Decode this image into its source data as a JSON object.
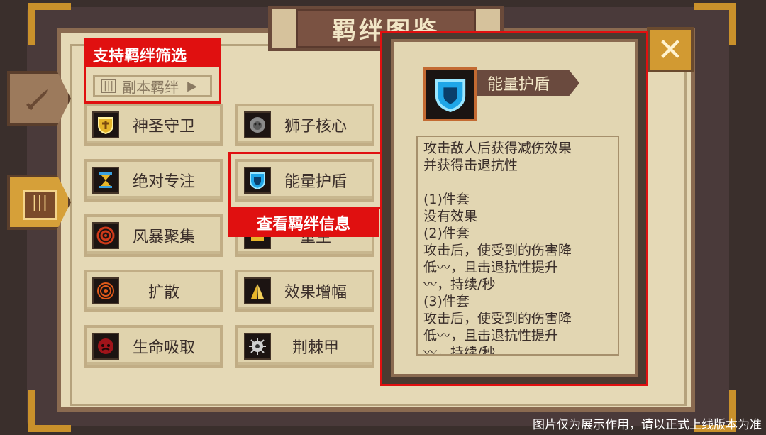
{
  "title": "羁绊图鉴",
  "close_icon": "✕",
  "filter": {
    "annotation": "支持羁绊筛选",
    "dropdown_label": "副本羁绊"
  },
  "bonds": [
    {
      "label": "神圣守卫",
      "icon": "holy-shield-icon"
    },
    {
      "label": "狮子核心",
      "icon": "lion-icon"
    },
    {
      "label": "绝对专注",
      "icon": "hourglass-icon"
    },
    {
      "label": "能量护盾",
      "icon": "energy-shield-icon"
    },
    {
      "label": "风暴聚集",
      "icon": "storm-icon"
    },
    {
      "label": "重生",
      "icon": "rebirth-icon"
    },
    {
      "label": "扩散",
      "icon": "spread-icon"
    },
    {
      "label": "效果增幅",
      "icon": "pray-icon"
    },
    {
      "label": "生命吸取",
      "icon": "life-drain-icon"
    },
    {
      "label": "荆棘甲",
      "icon": "thorn-armor-icon"
    }
  ],
  "view_annotation": "查看羁绊信息",
  "detail": {
    "name": "能量护盾",
    "description": "攻击敌人后获得减伤效果\n并获得击退抗性\n\n(1)件套\n没有效果\n(2)件套\n攻击后，使受到的伤害降\n低〰，且击退抗性提升\n〰，持续/秒\n(3)件套\n攻击后，使受到的伤害降\n低〰，且击退抗性提升\n〰，持续/秒"
  },
  "watermark": "图片仅为展示作用，请以正式上线版本为准",
  "colors": {
    "annotation_red": "#e01010",
    "panel_bg": "#e5d9b6",
    "accent_gold": "#d6a039"
  }
}
